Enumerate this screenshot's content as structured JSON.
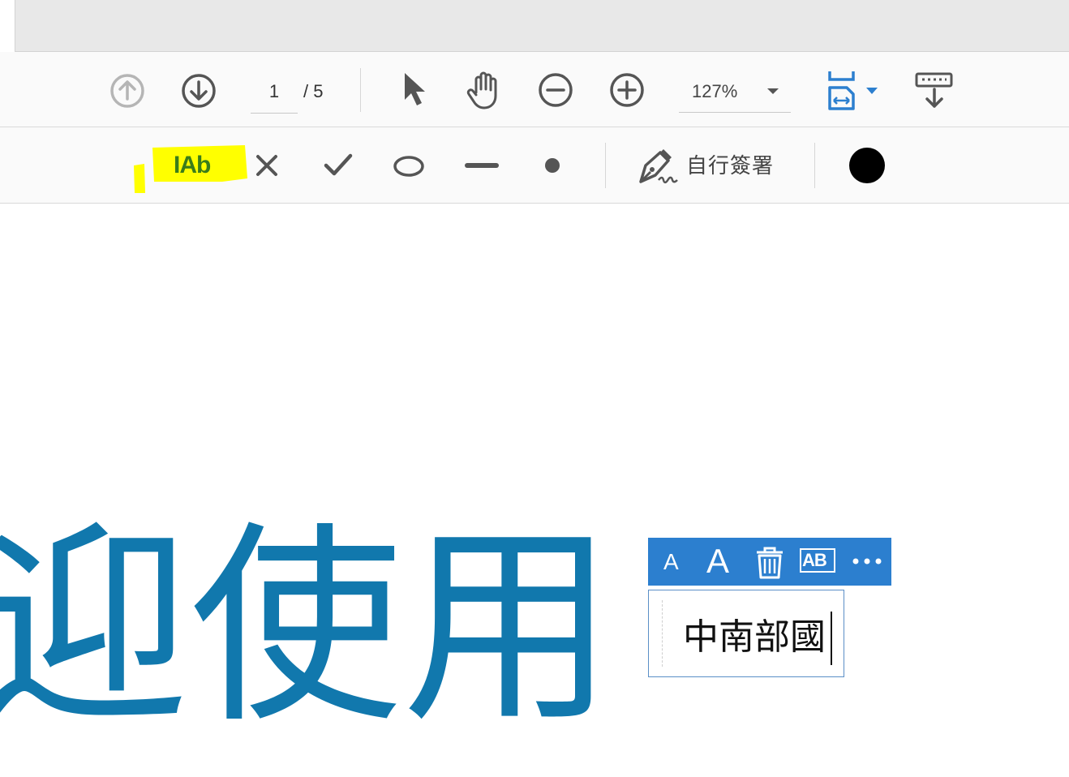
{
  "navigation": {
    "current_page": "1",
    "total_pages": "/ 5",
    "zoom": "127%"
  },
  "fill_sign_toolbar": {
    "add_text_label": "IAb",
    "sign_label": "自行簽署",
    "selected_color": "#000000",
    "highlight_color": "#ffff00"
  },
  "document": {
    "heading_text": "迎使用",
    "heading_color": "#1178ad"
  },
  "text_field": {
    "value": "中南部國",
    "toolbar_items": [
      "A",
      "A",
      "trash-icon",
      "AB",
      "more-icon"
    ]
  },
  "colors": {
    "accent_blue": "#2c7fcf",
    "icon_gray": "#555555"
  }
}
